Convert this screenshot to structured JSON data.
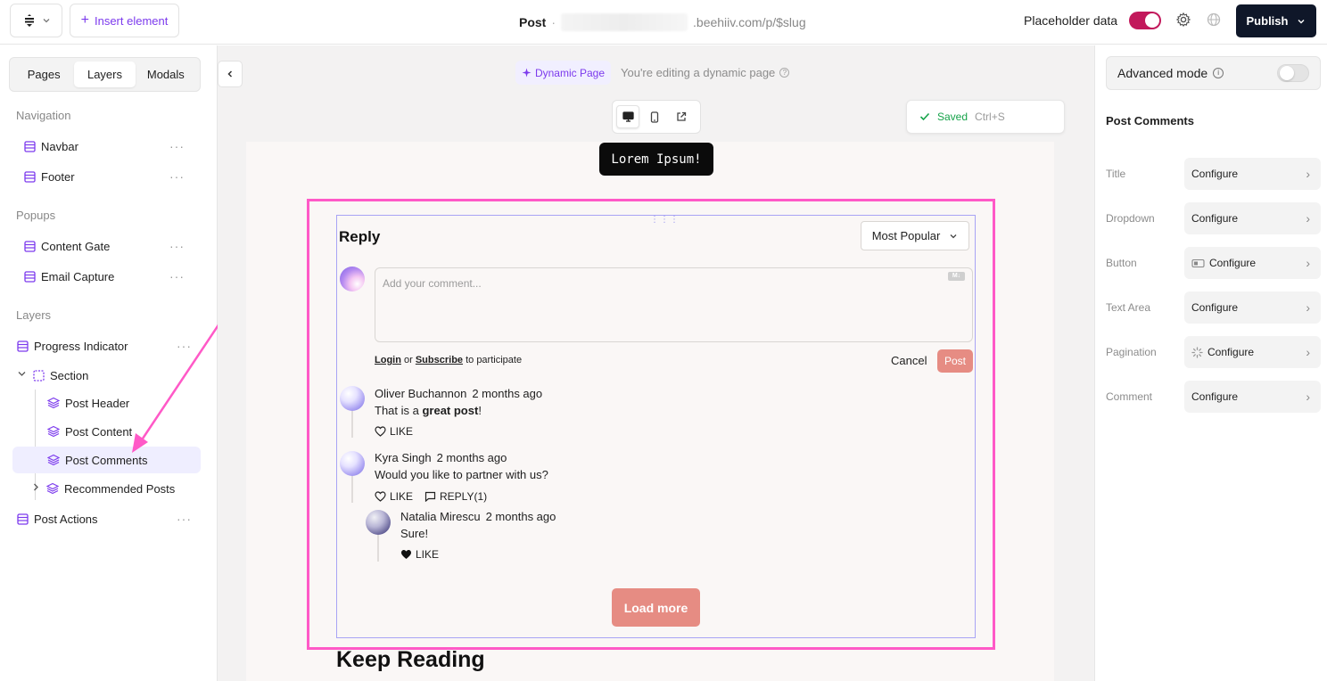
{
  "topbar": {
    "insert_label": "Insert element",
    "post_label": "Post",
    "separator": "·",
    "url_suffix": ".beehiiv.com/p/$slug",
    "placeholder_label": "Placeholder data",
    "placeholder_on": true,
    "publish_label": "Publish"
  },
  "sidebar": {
    "tabs": [
      {
        "label": "Pages",
        "active": false
      },
      {
        "label": "Layers",
        "active": true
      },
      {
        "label": "Modals",
        "active": false
      }
    ],
    "navigation_title": "Navigation",
    "navigation_items": [
      {
        "label": "Navbar"
      },
      {
        "label": "Footer"
      }
    ],
    "popups_title": "Popups",
    "popup_items": [
      {
        "label": "Content Gate"
      },
      {
        "label": "Email Capture"
      }
    ],
    "layers_title": "Layers",
    "layers": {
      "progress": "Progress Indicator",
      "section": "Section",
      "post_header": "Post Header",
      "post_content": "Post Content",
      "post_comments": "Post Comments",
      "recommended": "Recommended Posts",
      "post_actions": "Post Actions"
    },
    "more_glyph": "···"
  },
  "canvas": {
    "dynamic_chip": "Dynamic Page",
    "dynamic_note": "You're editing a dynamic page",
    "saved_label": "Saved",
    "saved_shortcut": "Ctrl+S",
    "lorem": "Lorem Ipsum!",
    "comments": {
      "title": "Reply",
      "sort_value": "Most Popular",
      "placeholder": "Add your comment...",
      "login": "Login",
      "or": " or ",
      "subscribe": "Subscribe",
      "participate": " to participate",
      "cancel": "Cancel",
      "post": "Post",
      "items": [
        {
          "author": "Oliver Buchannon",
          "time": "2 months ago",
          "text_before": "That is a ",
          "text_bold": "great post",
          "text_after": "!",
          "like": "LIKE"
        },
        {
          "author": "Kyra Singh",
          "time": "2 months ago",
          "text": "Would you like to partner with us?",
          "like": "LIKE",
          "reply": "REPLY(1)"
        },
        {
          "author": "Natalia Mirescu",
          "time": "2 months ago",
          "text": "Sure!",
          "like": "LIKE"
        }
      ],
      "load_more": "Load more"
    },
    "keep_reading": "Keep Reading"
  },
  "right_panel": {
    "advanced_label": "Advanced mode",
    "advanced_on": false,
    "title": "Post Comments",
    "configs": [
      {
        "label": "Title",
        "button": "Configure"
      },
      {
        "label": "Dropdown",
        "button": "Configure"
      },
      {
        "label": "Button",
        "button": "Configure"
      },
      {
        "label": "Text Area",
        "button": "Configure"
      },
      {
        "label": "Pagination",
        "button": "Configure"
      },
      {
        "label": "Comment",
        "button": "Configure"
      }
    ]
  },
  "colors": {
    "accent": "#7c3aed",
    "toggle_on": "#c2185b",
    "publish_bg": "#0f1729",
    "post_button": "#e68c83",
    "highlight": "#ff59c7"
  }
}
